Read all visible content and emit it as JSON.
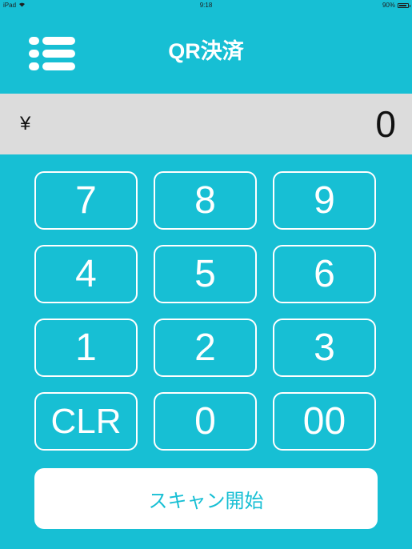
{
  "status_bar": {
    "device": "iPad",
    "time": "9:18",
    "battery_text": "90%",
    "battery_level": 0.9
  },
  "nav": {
    "title": "QR決済",
    "menu_icon": "list-menu-icon"
  },
  "amount": {
    "currency_symbol": "¥",
    "value": "0"
  },
  "keypad": {
    "k7": "7",
    "k8": "8",
    "k9": "9",
    "k4": "4",
    "k5": "5",
    "k6": "6",
    "k1": "1",
    "k2": "2",
    "k3": "3",
    "clear": "CLR",
    "k0": "0",
    "k00": "00"
  },
  "scan_button": {
    "label": "スキャン開始"
  },
  "colors": {
    "background": "#17bfd4",
    "amount_bar": "#dcdcdc",
    "key_border": "#ffffff",
    "scan_button_bg": "#ffffff",
    "scan_button_text": "#17bfd4"
  }
}
